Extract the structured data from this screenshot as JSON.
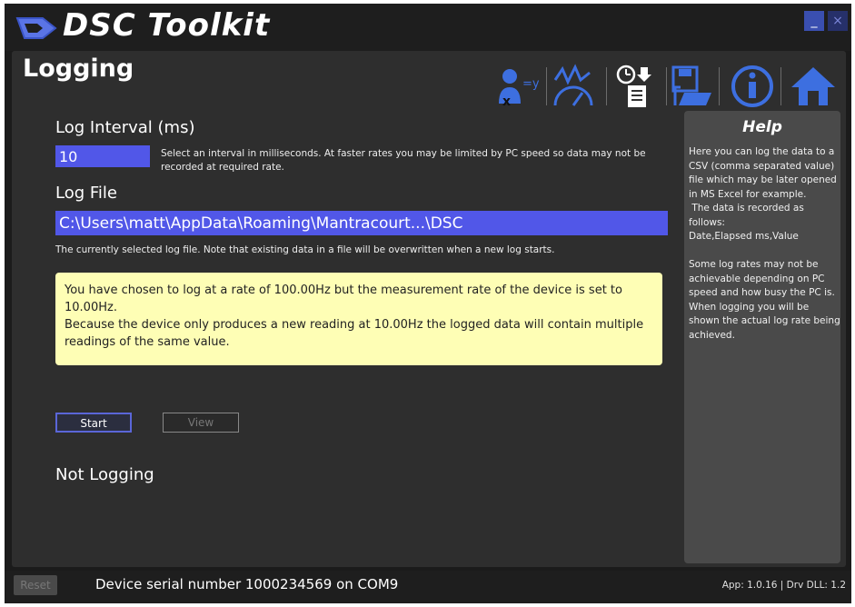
{
  "window": {
    "title": "DSC Toolkit",
    "minimize_label": "_",
    "close_label": "×"
  },
  "page": {
    "title": "Logging"
  },
  "toolbar": {
    "icons": [
      "formula-icon",
      "gauge-icon",
      "timer-log-icon",
      "save-open-icon",
      "info-icon",
      "home-icon"
    ]
  },
  "log_interval": {
    "label": "Log Interval (ms)",
    "value": "10",
    "description": "Select an interval in milliseconds. At faster rates you may be limited by PC speed so data may not be recorded at required rate."
  },
  "log_file": {
    "label": "Log File",
    "value": "C:\\Users\\matt\\AppData\\Roaming\\Mantracourt...\\DSC",
    "description": "The currently selected log file. Note that existing data in a file will be overwritten when a new log starts."
  },
  "warning": {
    "line1": "You have chosen to log at a rate of 100.00Hz but the measurement rate of the device is set to 10.00Hz.",
    "line2": "Because the device only produces a new reading at 10.00Hz the logged data will contain multiple readings of the same value."
  },
  "buttons": {
    "start": "Start",
    "view": "View"
  },
  "status": "Not Logging",
  "help": {
    "title": "Help",
    "text": "Here you can log the data to a CSV (comma separated value) file which may be later opened in MS Excel for example.\n The data is recorded as follows:\nDate,Elapsed ms,Value\n\nSome log rates may not be achievable depending on PC speed and how busy the PC is. When logging you will be shown the actual log rate being achieved."
  },
  "footer": {
    "reset": "Reset",
    "serial": "Device serial number 1000234569 on COM9",
    "version": "App: 1.0.16 | Drv DLL: 1.2"
  },
  "colors": {
    "accent": "#5157e8",
    "warning_bg": "#fefeb5",
    "icon_blue": "#3d6fe0"
  }
}
